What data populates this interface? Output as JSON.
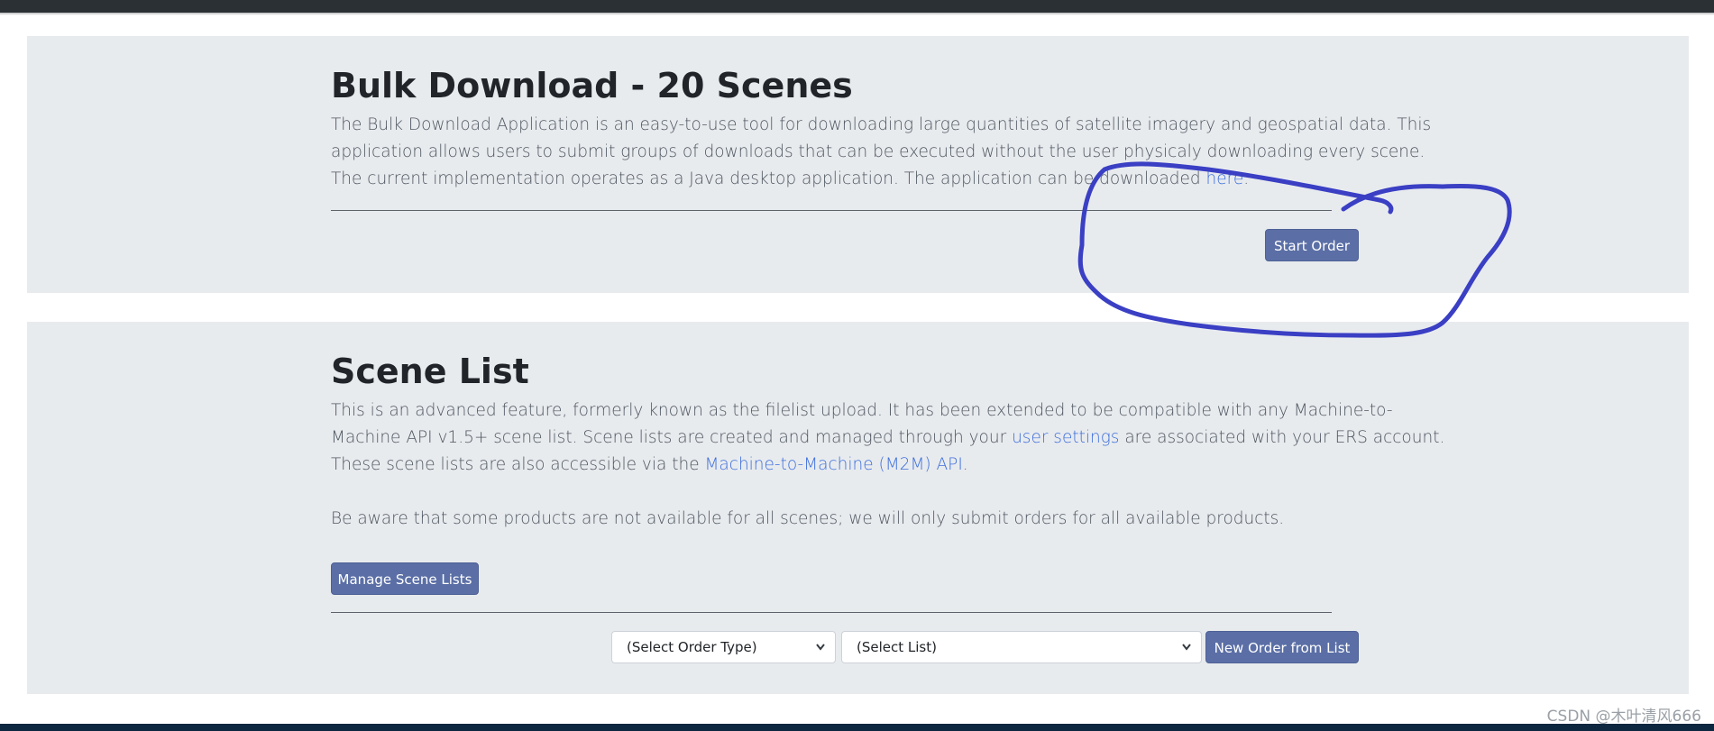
{
  "bulk": {
    "title": "Bulk Download - 20 Scenes",
    "line1": "The Bulk Download Application is an easy-to-use tool for downloading large quantities of satellite imagery and geospatial data. This",
    "line2": "application allows users to submit groups of downloads that can be executed without the user physicaly downloading every scene.",
    "line3_prefix": "The current implementation operates as a Java desktop application. The application can be downloaded ",
    "line3_link": "here",
    "line3_suffix": ".",
    "start_order_label": "Start Order"
  },
  "scene_list": {
    "title": "Scene List",
    "line1": "This is an advanced feature, formerly known as the filelist upload. It has been extended to be compatible with any Machine-to-",
    "line2_prefix": "Machine API v1.5+ scene list. Scene lists are created and managed through your ",
    "line2_link": "user settings",
    "line2_suffix": " are associated with your ERS account.",
    "line3_prefix": "These scene lists are also accessible via the ",
    "line3_link": "Machine-to-Machine (M2M) API",
    "line3_suffix": ".",
    "note": "Be aware that some products are not available for all scenes; we will only submit orders for all available products.",
    "manage_label": "Manage Scene Lists",
    "order_type_select": "(Select Order Type)",
    "list_select": "(Select List)",
    "new_order_label": "New Order from List"
  },
  "watermark": "CSDN @木叶清风666",
  "colors": {
    "panel_bg": "#e8ebee",
    "button_bg": "#5b6fa6",
    "link": "#3e6fdc",
    "annotation_ink": "#3a3fc4"
  }
}
